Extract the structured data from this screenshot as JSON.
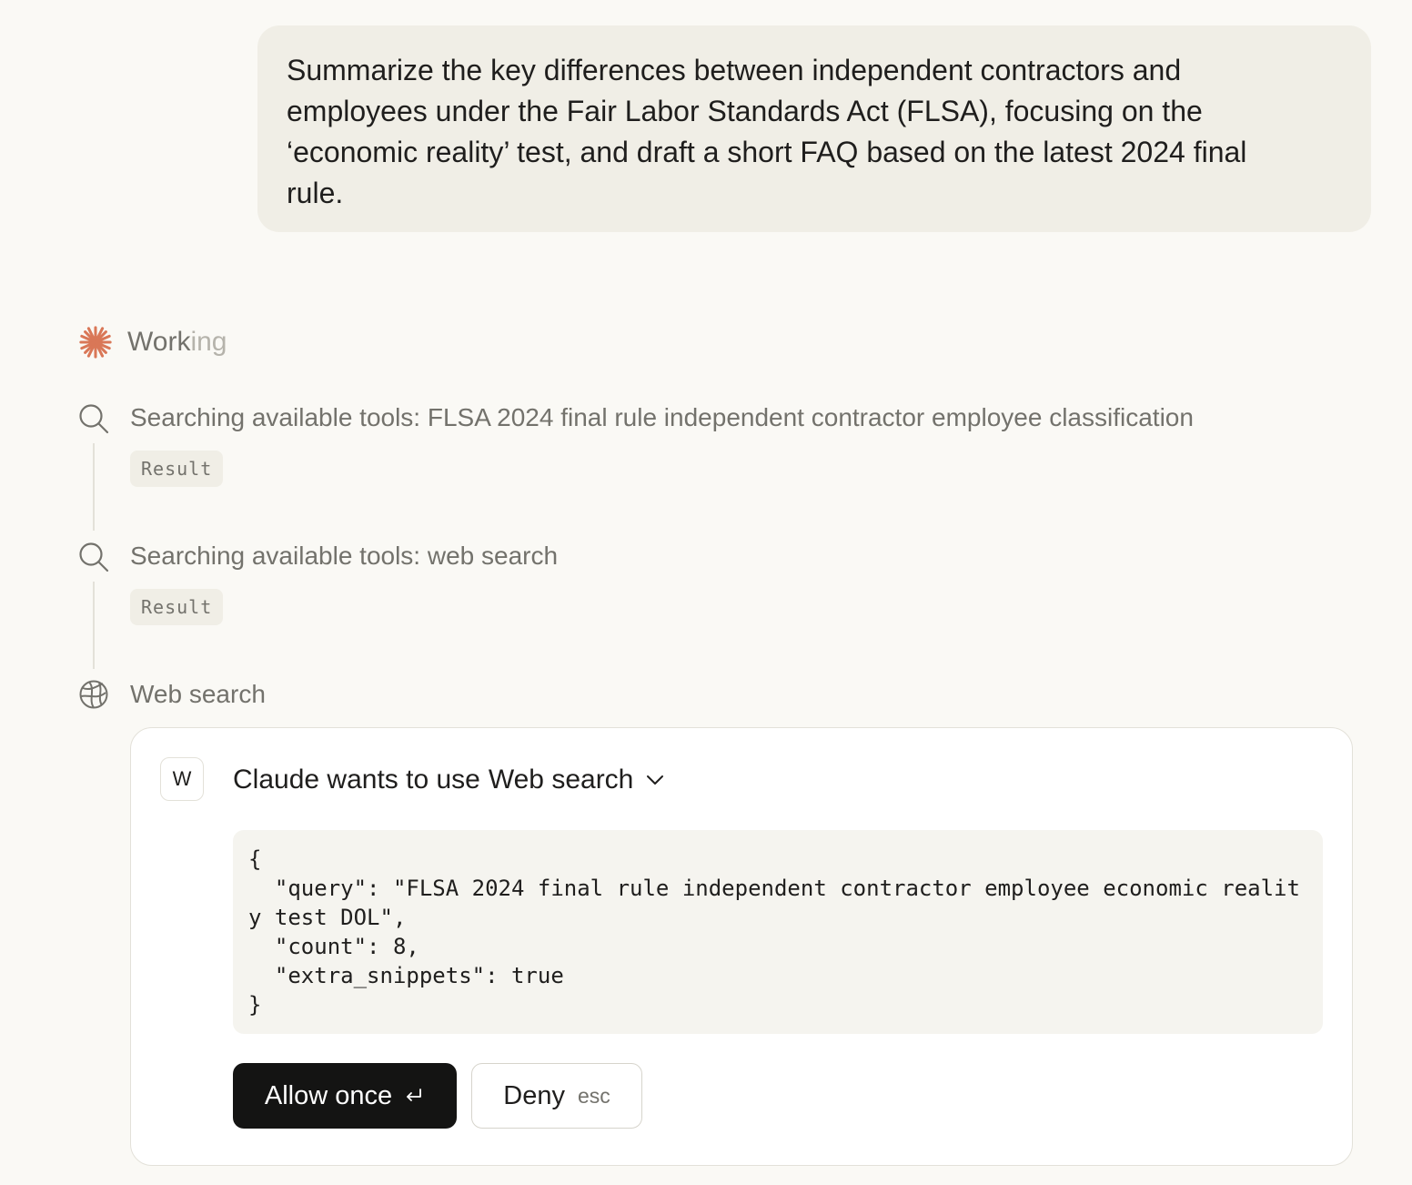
{
  "user_message": {
    "lines": [
      "Summarize the key differences between independent contractors and",
      "employees under the Fair Labor Standards Act (FLSA), focusing on the",
      "‘economic reality’ test, and draft a short FAQ based on the latest 2024 final",
      "rule."
    ]
  },
  "status": {
    "label_main": "Work",
    "label_fade": "ing",
    "icon": "asterisk-spark-icon",
    "accent_color": "#d97757"
  },
  "steps": [
    {
      "icon": "search-icon",
      "text": "Searching available tools: FLSA 2024 final rule independent contractor employee classification",
      "result_label": "Result"
    },
    {
      "icon": "search-icon",
      "text": "Searching available tools: web search",
      "result_label": "Result"
    },
    {
      "icon": "globe-icon",
      "text": "Web search"
    }
  ],
  "permission": {
    "badge_letter": "W",
    "title_prefix": "Claude wants to use",
    "tool_name": "Web search",
    "code_lines": [
      "{",
      "  \"query\": \"FLSA 2024 final rule independent contractor employee economic realit",
      "y test DOL\",",
      "  \"count\": 8,",
      "  \"extra_snippets\": true",
      "}"
    ],
    "allow_label": "Allow once",
    "deny_label": "Deny",
    "deny_shortcut": "esc"
  }
}
